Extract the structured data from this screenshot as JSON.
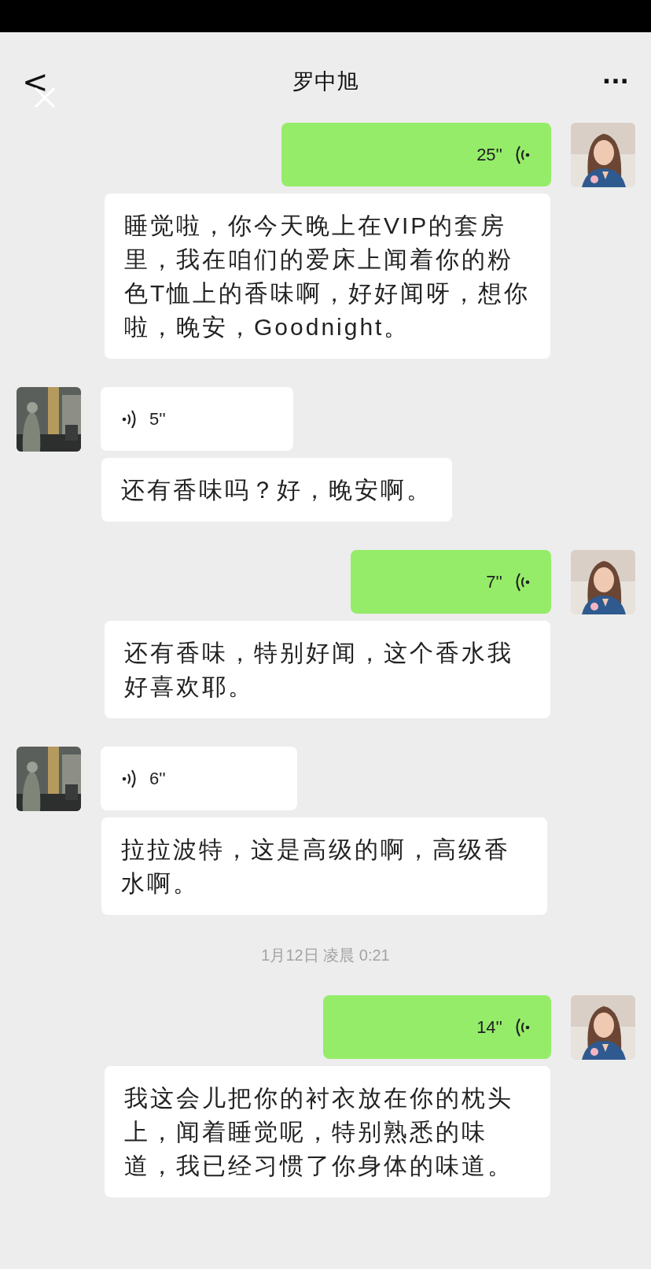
{
  "header": {
    "back": "<",
    "title": "罗中旭",
    "more": "···"
  },
  "messages": [
    {
      "kind": "voice",
      "outgoing": true,
      "duration": "25''"
    },
    {
      "kind": "transcript",
      "text": "睡觉啦，你今天晚上在VIP的套房里，我在咱们的爱床上闻着你的粉色T恤上的香味啊，好好闻呀，想你啦，晚安，Goodnight。"
    },
    {
      "kind": "voice",
      "outgoing": false,
      "duration": "5''"
    },
    {
      "kind": "transcript",
      "text": "还有香味吗？好，晚安啊。"
    },
    {
      "kind": "voice",
      "outgoing": true,
      "duration": "7''"
    },
    {
      "kind": "transcript",
      "text": "还有香味，特别好闻，这个香水我好喜欢耶。"
    },
    {
      "kind": "voice",
      "outgoing": false,
      "duration": "6''"
    },
    {
      "kind": "transcript",
      "text": "拉拉波特，这是高级的啊，高级香水啊。"
    },
    {
      "kind": "time",
      "text": "1月12日 凌晨 0:21"
    },
    {
      "kind": "voice",
      "outgoing": true,
      "duration": "14''"
    },
    {
      "kind": "transcript",
      "text": "我这会儿把你的衬衣放在你的枕头上，闻着睡觉呢，特别熟悉的味道，我已经习惯了你身体的味道。"
    }
  ]
}
